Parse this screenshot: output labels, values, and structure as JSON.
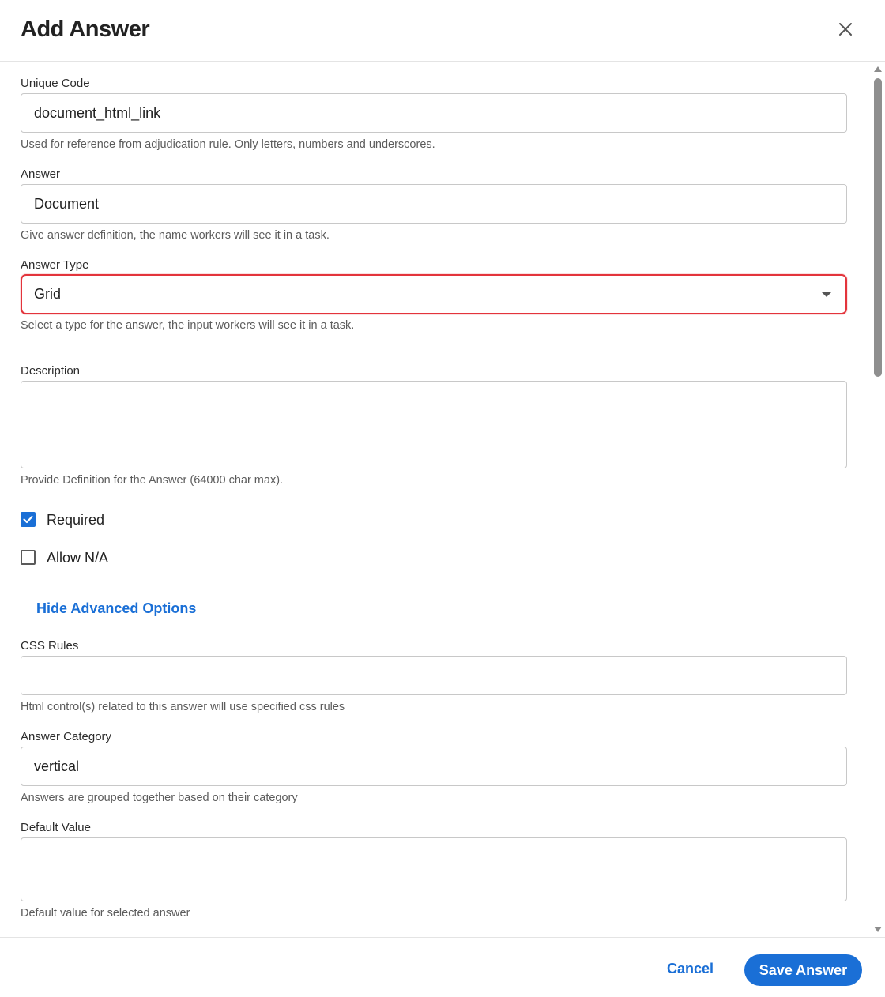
{
  "dialog": {
    "title": "Add Answer"
  },
  "form": {
    "unique_code": {
      "label": "Unique Code",
      "value": "document_html_link",
      "help": "Used for reference from adjudication rule. Only letters, numbers and underscores."
    },
    "answer": {
      "label": "Answer",
      "value": "Document",
      "help": "Give answer definition, the name workers will see it in a task."
    },
    "answer_type": {
      "label": "Answer Type",
      "value": "Grid",
      "help": "Select a type for the answer, the input workers will see it in a task."
    },
    "description": {
      "label": "Description",
      "value": "",
      "help": "Provide Definition for the Answer (64000 char max)."
    },
    "required": {
      "label": "Required",
      "checked": true
    },
    "allow_na": {
      "label": "Allow N/A",
      "checked": false
    },
    "advanced_toggle": "Hide Advanced Options",
    "css_rules": {
      "label": "CSS Rules",
      "value": "",
      "help": "Html control(s) related to this answer will use specified css rules"
    },
    "answer_category": {
      "label": "Answer Category",
      "value": "vertical",
      "help": "Answers are grouped together based on their category"
    },
    "default_value": {
      "label": "Default Value",
      "value": "",
      "help": "Default value for selected answer"
    }
  },
  "footer": {
    "cancel_label": "Cancel",
    "save_label": "Save Answer"
  },
  "colors": {
    "accent": "#1a6fd6",
    "focus_border": "#e3343c",
    "help_text": "#5c5c5c"
  },
  "icons": {
    "close": "close-icon",
    "dropdown": "chevron-down-icon",
    "check": "checkmark-icon"
  }
}
